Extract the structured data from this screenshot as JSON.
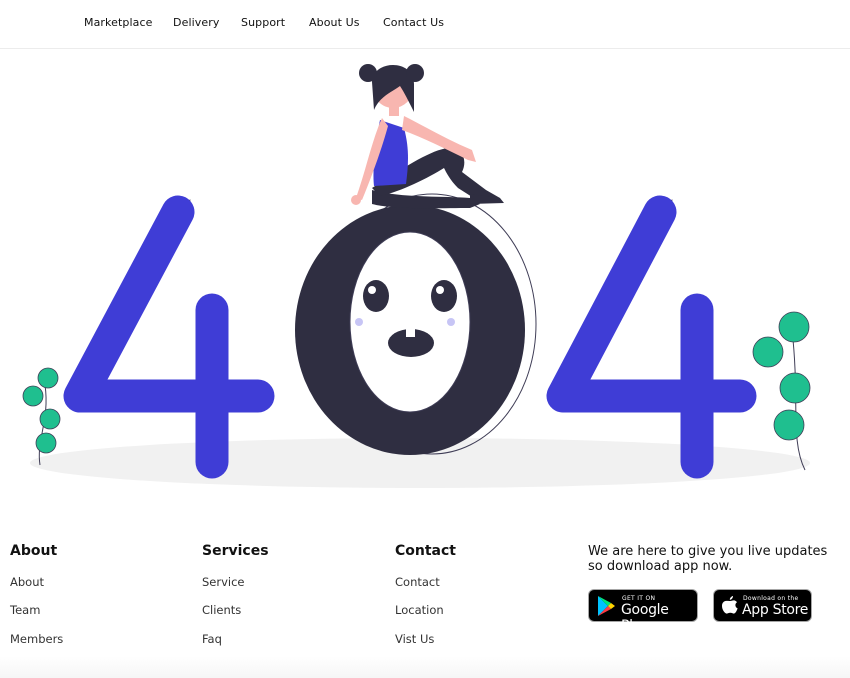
{
  "nav": {
    "items": [
      "Marketplace",
      "Delivery",
      "Support",
      "About Us",
      "Contact Us"
    ]
  },
  "illustration": {
    "accent_color": "#3f3dd6",
    "dark_color": "#2f2e41",
    "leaf_color": "#1fbf8f",
    "skin_color": "#f8b6b0"
  },
  "footer": {
    "about": {
      "title": "About",
      "links": [
        "About",
        "Team",
        "Members"
      ]
    },
    "services": {
      "title": "Services",
      "links": [
        "Service",
        "Clients",
        "Faq"
      ]
    },
    "contact": {
      "title": "Contact",
      "links": [
        "Contact",
        "Location",
        "Vist Us"
      ]
    },
    "app": {
      "tagline": "We are here to give you live updates so download app now.",
      "google_play": {
        "small": "GET IT ON",
        "big": "Google Play",
        "icon": "google-play-icon"
      },
      "app_store": {
        "small": "Download on the",
        "big": "App Store",
        "icon": "apple-icon"
      }
    }
  }
}
